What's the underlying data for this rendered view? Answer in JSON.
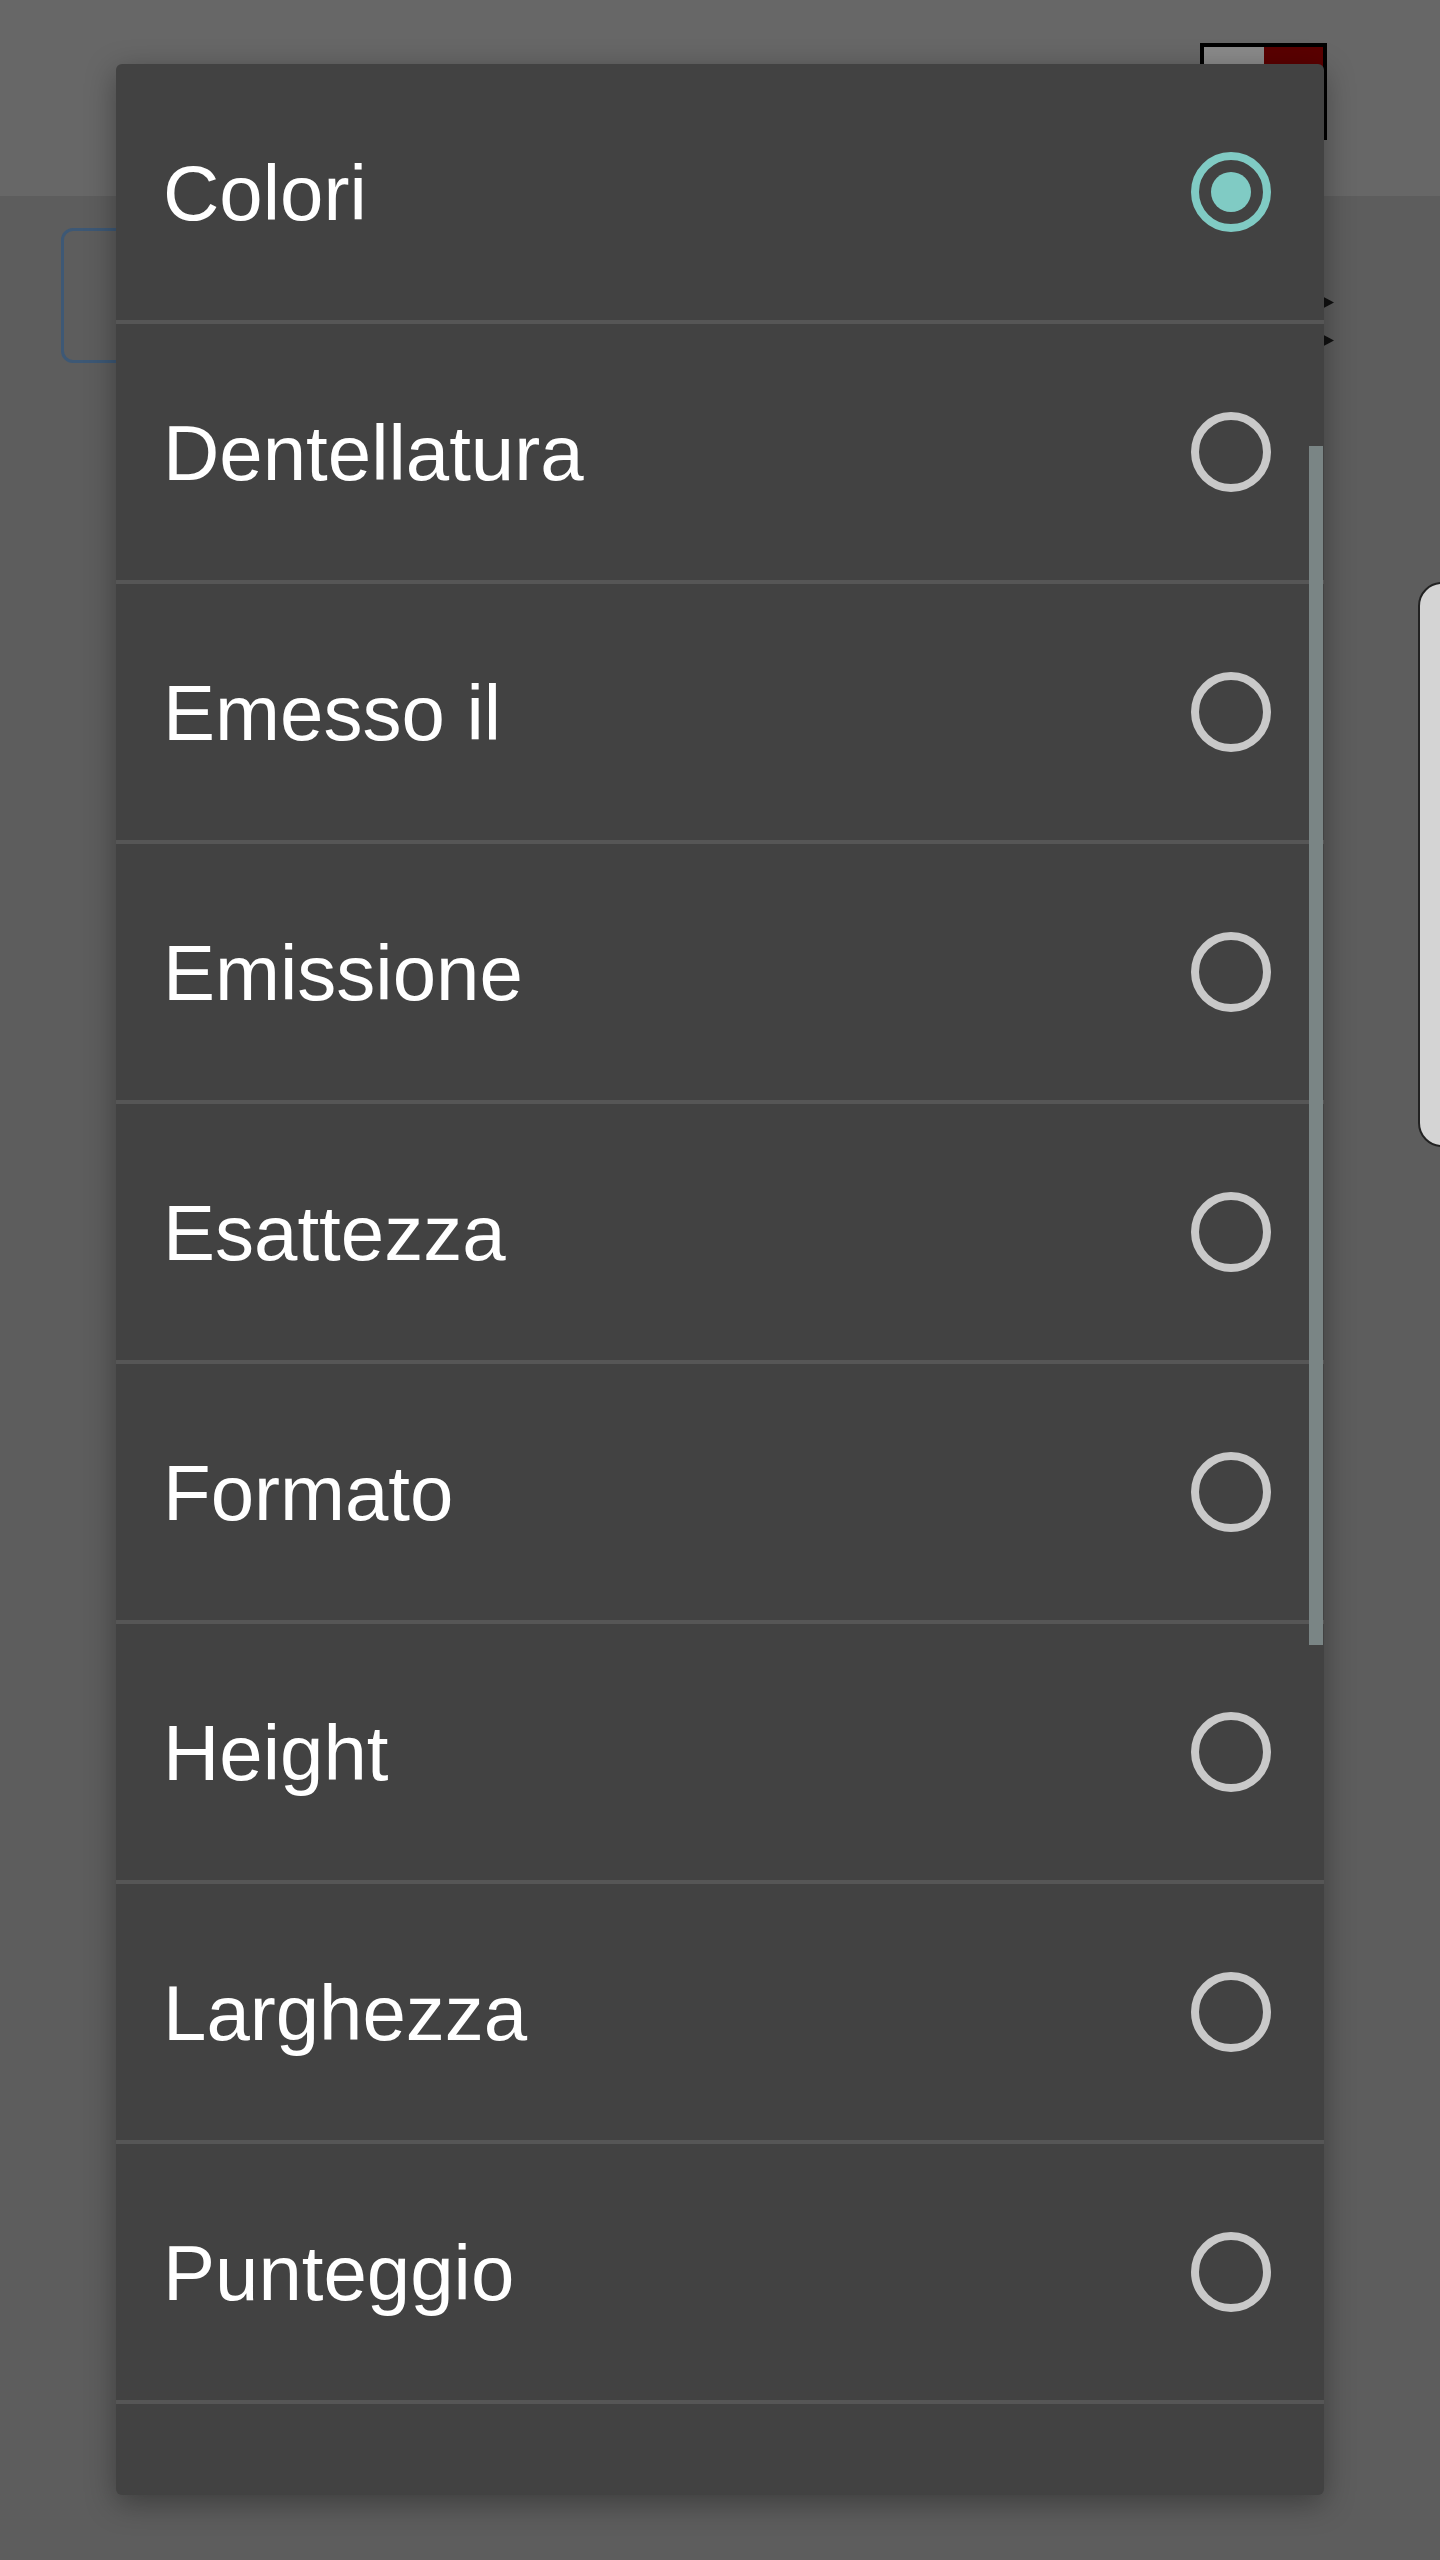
{
  "dialog": {
    "options": [
      {
        "label": "Colori",
        "selected": true
      },
      {
        "label": "Dentellatura",
        "selected": false
      },
      {
        "label": "Emesso il",
        "selected": false
      },
      {
        "label": "Emissione",
        "selected": false
      },
      {
        "label": "Esattezza",
        "selected": false
      },
      {
        "label": "Formato",
        "selected": false
      },
      {
        "label": "Height",
        "selected": false
      },
      {
        "label": "Larghezza",
        "selected": false
      },
      {
        "label": "Punteggio",
        "selected": false
      }
    ]
  }
}
